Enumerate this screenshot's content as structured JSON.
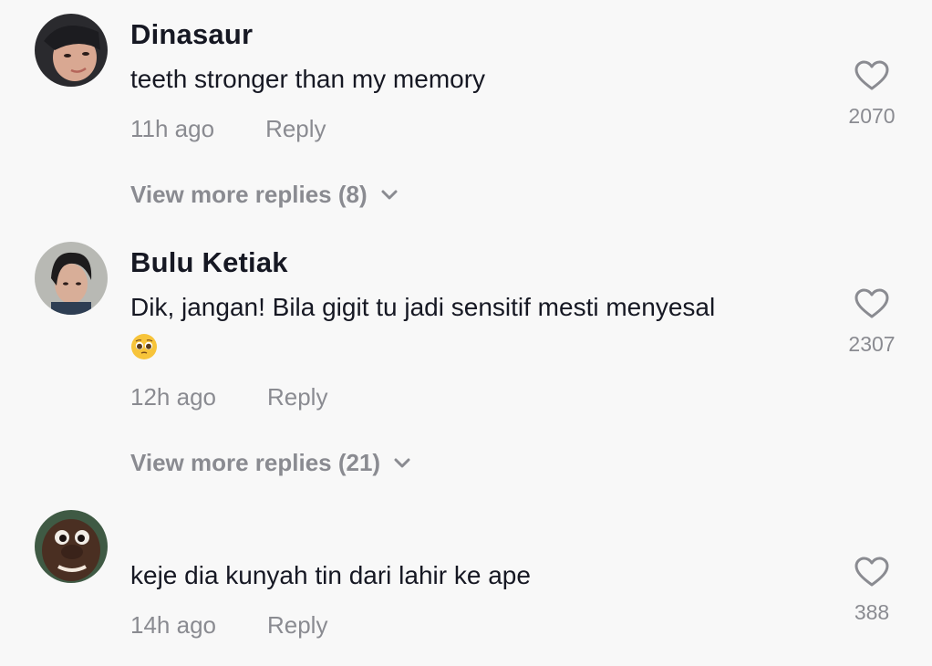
{
  "comments": [
    {
      "username": "Dinasaur",
      "text": "teeth stronger than my memory",
      "time": "11h ago",
      "reply_label": "Reply",
      "likes": "2070",
      "more_replies": "View more replies (8)",
      "avatar_icon": "avatar-girl-photo"
    },
    {
      "username": "Bulu Ketiak",
      "text": "Dik, jangan! Bila gigit tu jadi sensitif mesti menyesal",
      "emoji": "pleading-face-emoji",
      "time": "12h ago",
      "reply_label": "Reply",
      "likes": "2307",
      "more_replies": "View more replies (21)",
      "avatar_icon": "avatar-boy-photo"
    },
    {
      "username": "",
      "text": "keje dia kunyah tin dari lahir ke ape",
      "time": "14h ago",
      "reply_label": "Reply",
      "likes": "388",
      "avatar_icon": "avatar-face-photo"
    }
  ],
  "colors": {
    "background": "#f8f8f8",
    "primary_text": "#161823",
    "secondary_text": "#8a8b91"
  }
}
